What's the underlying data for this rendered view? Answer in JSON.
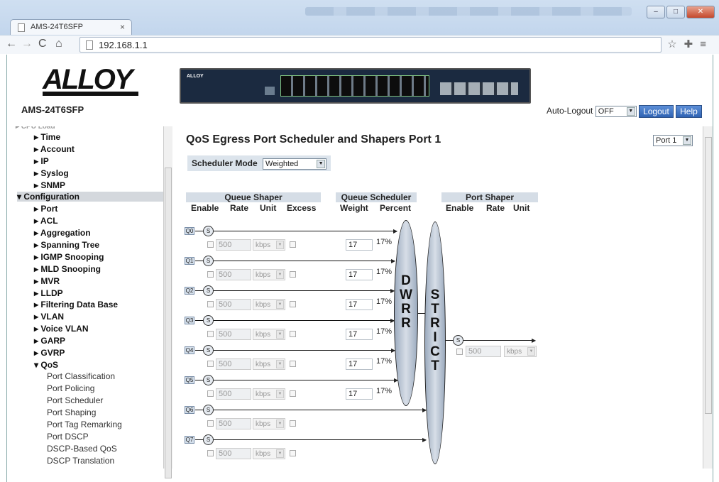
{
  "browser": {
    "tab_title": "AMS-24T6SFP",
    "tab_close": "×",
    "url": "192.168.1.1"
  },
  "header": {
    "logo_text": "ALLOY",
    "model": "AMS-24T6SFP",
    "device_label": "ALLOY",
    "auto_logout_label": "Auto-Logout",
    "auto_logout_value": "OFF",
    "logout_label": "Logout",
    "help_label": "Help"
  },
  "sidebar": {
    "items": [
      {
        "label": "▸ Time",
        "level": 1
      },
      {
        "label": "▸ Account",
        "level": 1
      },
      {
        "label": "▸ IP",
        "level": 1
      },
      {
        "label": "▸ Syslog",
        "level": 1
      },
      {
        "label": "▸ SNMP",
        "level": 1
      },
      {
        "label": "▾ Configuration",
        "level": 0
      },
      {
        "label": "▸ Port",
        "level": 1
      },
      {
        "label": "▸ ACL",
        "level": 1
      },
      {
        "label": "▸ Aggregation",
        "level": 1
      },
      {
        "label": "▸ Spanning Tree",
        "level": 1
      },
      {
        "label": "▸ IGMP Snooping",
        "level": 1
      },
      {
        "label": "▸ MLD Snooping",
        "level": 1
      },
      {
        "label": "▸ MVR",
        "level": 1
      },
      {
        "label": "▸ LLDP",
        "level": 1
      },
      {
        "label": "▸ Filtering Data Base",
        "level": 1
      },
      {
        "label": "▸ VLAN",
        "level": 1
      },
      {
        "label": "▸ Voice VLAN",
        "level": 1
      },
      {
        "label": "▸ GARP",
        "level": 1
      },
      {
        "label": "▸ GVRP",
        "level": 1
      },
      {
        "label": "▾ QoS",
        "level": 1
      },
      {
        "label": "Port Classification",
        "level": 2
      },
      {
        "label": "Port Policing",
        "level": 2
      },
      {
        "label": "Port Scheduler",
        "level": 2
      },
      {
        "label": "Port Shaping",
        "level": 2
      },
      {
        "label": "Port Tag Remarking",
        "level": 2
      },
      {
        "label": "Port DSCP",
        "level": 2
      },
      {
        "label": "DSCP-Based QoS",
        "level": 2
      },
      {
        "label": "DSCP Translation",
        "level": 2
      }
    ]
  },
  "main": {
    "title": "QoS Egress Port Scheduler and Shapers  Port 1",
    "port_select": "Port 1",
    "scheduler_mode_label": "Scheduler Mode",
    "scheduler_mode_value": "Weighted",
    "queue_shaper_header": "Queue Shaper",
    "queue_scheduler_header": "Queue Scheduler",
    "port_shaper_header": "Port Shaper",
    "cols": {
      "enable": "Enable",
      "rate": "Rate",
      "unit": "Unit",
      "excess": "Excess",
      "weight": "Weight",
      "percent": "Percent",
      "ps_enable": "Enable",
      "ps_rate": "Rate",
      "ps_unit": "Unit"
    },
    "queues": [
      {
        "label": "Q0",
        "rate": "500",
        "unit": "kbps",
        "weight": "17",
        "percent": "17%"
      },
      {
        "label": "Q1",
        "rate": "500",
        "unit": "kbps",
        "weight": "17",
        "percent": "17%"
      },
      {
        "label": "Q2",
        "rate": "500",
        "unit": "kbps",
        "weight": "17",
        "percent": "17%"
      },
      {
        "label": "Q3",
        "rate": "500",
        "unit": "kbps",
        "weight": "17",
        "percent": "17%"
      },
      {
        "label": "Q4",
        "rate": "500",
        "unit": "kbps",
        "weight": "17",
        "percent": "17%"
      },
      {
        "label": "Q5",
        "rate": "500",
        "unit": "kbps",
        "weight": "17",
        "percent": "17%"
      },
      {
        "label": "Q6",
        "rate": "500",
        "unit": "kbps"
      },
      {
        "label": "Q7",
        "rate": "500",
        "unit": "kbps"
      }
    ],
    "dwrr_text": "D W R R",
    "strict_text": "S T R I C T",
    "shaper_symbol": "S",
    "port_shaper_rate": "500",
    "port_shaper_unit": "kbps"
  }
}
